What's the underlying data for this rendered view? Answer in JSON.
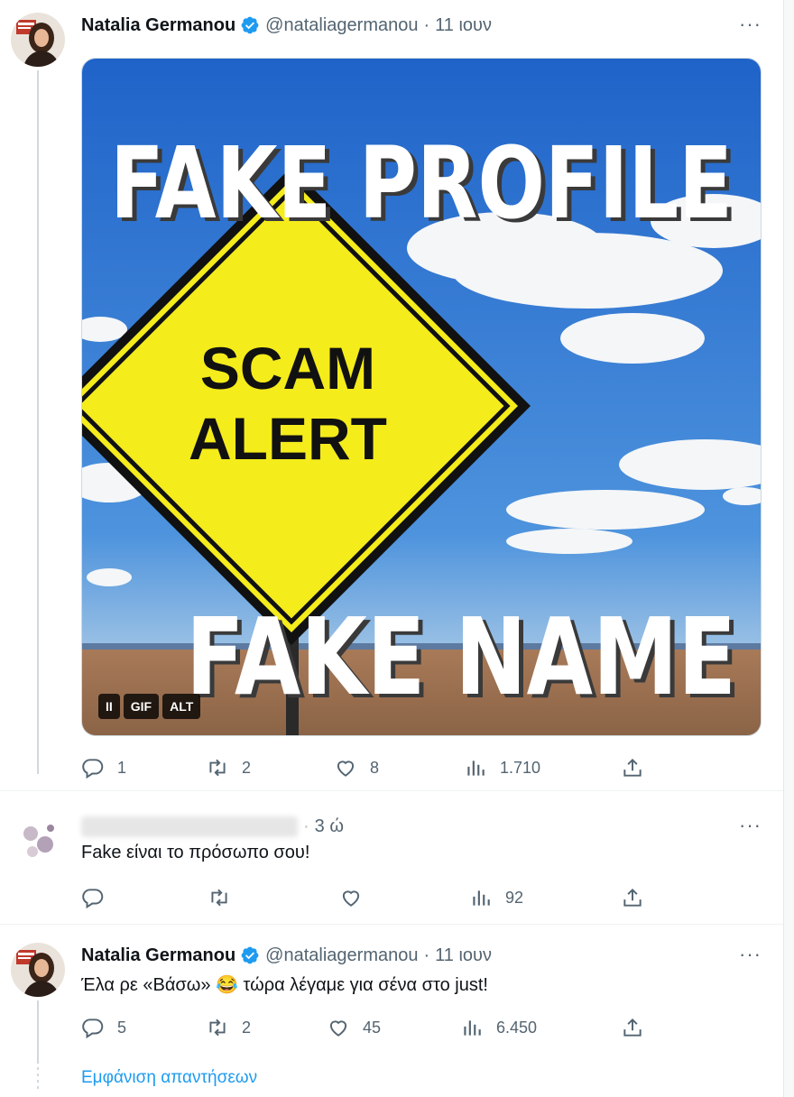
{
  "colors": {
    "accent": "#1d9bf0",
    "muted": "#536471",
    "text": "#0f1419"
  },
  "tweet1": {
    "name": "Natalia Germanou",
    "handle": "@nataliagermanou",
    "separator": "·",
    "date": "11 ιουν",
    "more": "···",
    "media": {
      "headline_top": "FAKE PROFILE",
      "sign_line1": "SCAM",
      "sign_line2": "ALERT",
      "headline_bottom": "FAKE NAME",
      "pause_label": "II",
      "gif_label": "GIF",
      "alt_label": "ALT"
    },
    "actions": {
      "replies": "1",
      "retweets": "2",
      "likes": "8",
      "views": "1.710"
    }
  },
  "tweet2": {
    "name_blurred": "            ",
    "time": "3 ώ",
    "more": "···",
    "text": "Fake είναι το πρόσωπο σου!",
    "actions": {
      "views": "92"
    }
  },
  "tweet3": {
    "name": "Natalia Germanou",
    "handle": "@nataliagermanou",
    "separator": "·",
    "date": "11 ιουν",
    "more": "···",
    "text": "Έλα ρε «Βάσω» 😂 τώρα λέγαμε για σένα στο just!",
    "actions": {
      "replies": "5",
      "retweets": "2",
      "likes": "45",
      "views": "6.450"
    }
  },
  "show_replies": "Εμφάνιση απαντήσεων"
}
